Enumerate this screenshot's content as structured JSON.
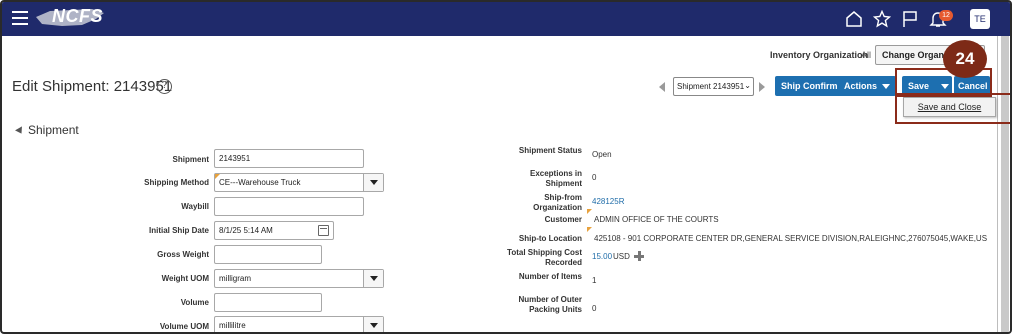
{
  "header": {
    "logo_text": "NCFS",
    "avatar_initials": "TE",
    "notification_count": "12",
    "icons": [
      "menu-icon",
      "home-icon",
      "star-icon",
      "flag-icon",
      "bell-icon"
    ]
  },
  "inventory_org": {
    "label": "Inventory Organization",
    "value": "All",
    "change_button": "Change Organization"
  },
  "page": {
    "title": "Edit Shipment: 2143951",
    "help": "?"
  },
  "toolbar": {
    "shipment_select": "Shipment 2143951",
    "ship_confirm": "Ship Confirm",
    "actions": "Actions",
    "save": "Save",
    "cancel": "Cancel",
    "save_and_close": "Save and Close"
  },
  "callout": {
    "step": "24",
    "color": "#7d2a17"
  },
  "section": {
    "title": "Shipment"
  },
  "form": {
    "shipment": {
      "label": "Shipment",
      "value": "2143951"
    },
    "shipping_method": {
      "label": "Shipping Method",
      "value": "CE---Warehouse Truck"
    },
    "waybill": {
      "label": "Waybill",
      "value": ""
    },
    "initial_ship_date": {
      "label": "Initial Ship Date",
      "value": "8/1/25 5:14 AM"
    },
    "gross_weight": {
      "label": "Gross Weight",
      "value": ""
    },
    "weight_uom": {
      "label": "Weight UOM",
      "value": "milligram"
    },
    "volume": {
      "label": "Volume",
      "value": ""
    },
    "volume_uom": {
      "label": "Volume UOM",
      "value": "millilitre"
    }
  },
  "details": {
    "shipment_status": {
      "label": "Shipment Status",
      "value": "Open"
    },
    "exceptions": {
      "label": "Exceptions in Shipment",
      "value": "0"
    },
    "ship_from": {
      "label": "Ship-from Organization",
      "value": "428125R"
    },
    "customer": {
      "label": "Customer",
      "value": "ADMIN OFFICE OF THE COURTS"
    },
    "ship_to": {
      "label": "Ship-to Location",
      "value": "425108 - 901 CORPORATE CENTER DR,GENERAL SERVICE DIVISION,RALEIGHNC,276075045,WAKE,US"
    },
    "total_cost": {
      "label": "Total Shipping Cost Recorded",
      "value": "15.00",
      "currency": "USD"
    },
    "num_items": {
      "label": "Number of Items",
      "value": "1"
    },
    "num_outer": {
      "label": "Number of Outer Packing Units",
      "value": "0"
    }
  },
  "colors": {
    "header_bg": "#1f2a6b",
    "button_blue": "#1d6fb0",
    "link": "#1f6ca8",
    "highlight": "#8b2b1a"
  }
}
